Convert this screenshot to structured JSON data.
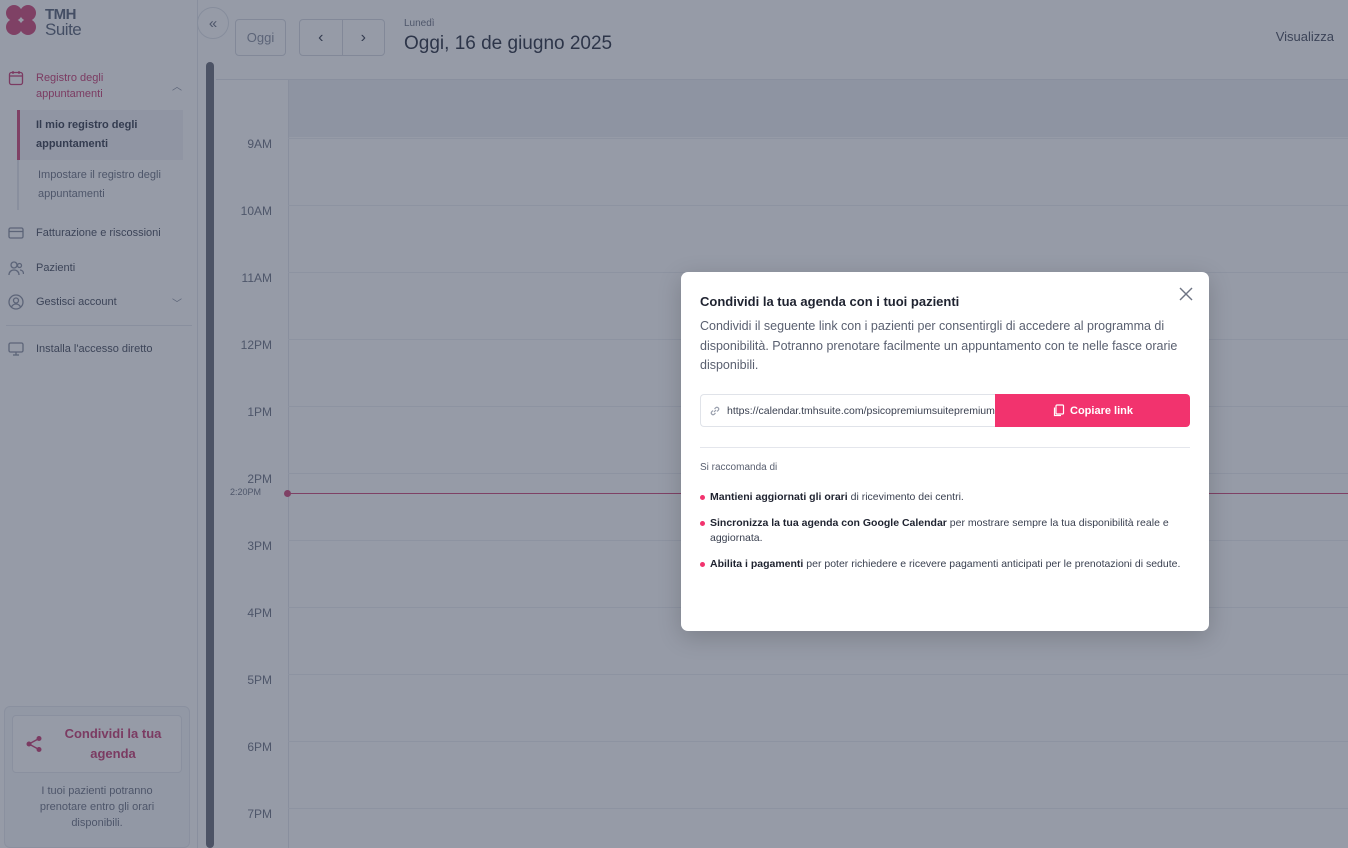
{
  "app": {
    "logo_line1": "TMH",
    "logo_line2": "Suite"
  },
  "sidebar": {
    "section_agenda": "Registro degli appuntamenti",
    "sub_items": [
      "Il mio registro degli appuntamenti",
      "Impostare il registro degli appuntamenti"
    ],
    "billing": "Fatturazione e riscossioni",
    "patients": "Pazienti",
    "account": "Gestisci account",
    "install": "Installa l'accesso diretto",
    "share_card": {
      "title": "Condividi la tua agenda",
      "desc": "I tuoi pazienti potranno prenotare entro gli orari disponibili."
    }
  },
  "header": {
    "today_btn": "Oggi",
    "prev_icon": "‹",
    "next_icon": "›",
    "weekday": "Lunedì",
    "date_title": "Oggi, 16 de giugno 2025",
    "view_label": "Visualizza"
  },
  "calendar": {
    "hours": [
      "9AM",
      "10AM",
      "11AM",
      "12PM",
      "1PM",
      "2PM",
      "3PM",
      "4PM",
      "5PM",
      "6PM",
      "7PM"
    ],
    "now_label": "2:20PM"
  },
  "modal": {
    "title": "Condividi la tua agenda con i tuoi pazienti",
    "desc": "Condividi il seguente link con i pazienti per consentirgli di accedere al programma di disponibilità. Potranno prenotare facilmente un appuntamento con te nelle fasce orarie disponibili.",
    "link_value": "https://calendar.tmhsuite.com/psicopremiumsuitepremium",
    "copy_label": "Copiare link",
    "rec_title": "Si raccomanda di",
    "recommendations": [
      {
        "bold": "Mantieni aggiornati gli orari",
        "rest": " di ricevimento dei centri."
      },
      {
        "bold": "Sincronizza la tua agenda con Google Calendar",
        "rest": " per mostrare sempre la tua disponibilità reale e aggiornata."
      },
      {
        "bold": "Abilita i pagamenti",
        "rest": " per poter richiedere e ricevere pagamenti anticipati per le prenotazioni di sedute."
      }
    ]
  },
  "colors": {
    "accent": "#f2336e",
    "brand": "#d14a7a",
    "overlay": "#2e3850"
  }
}
